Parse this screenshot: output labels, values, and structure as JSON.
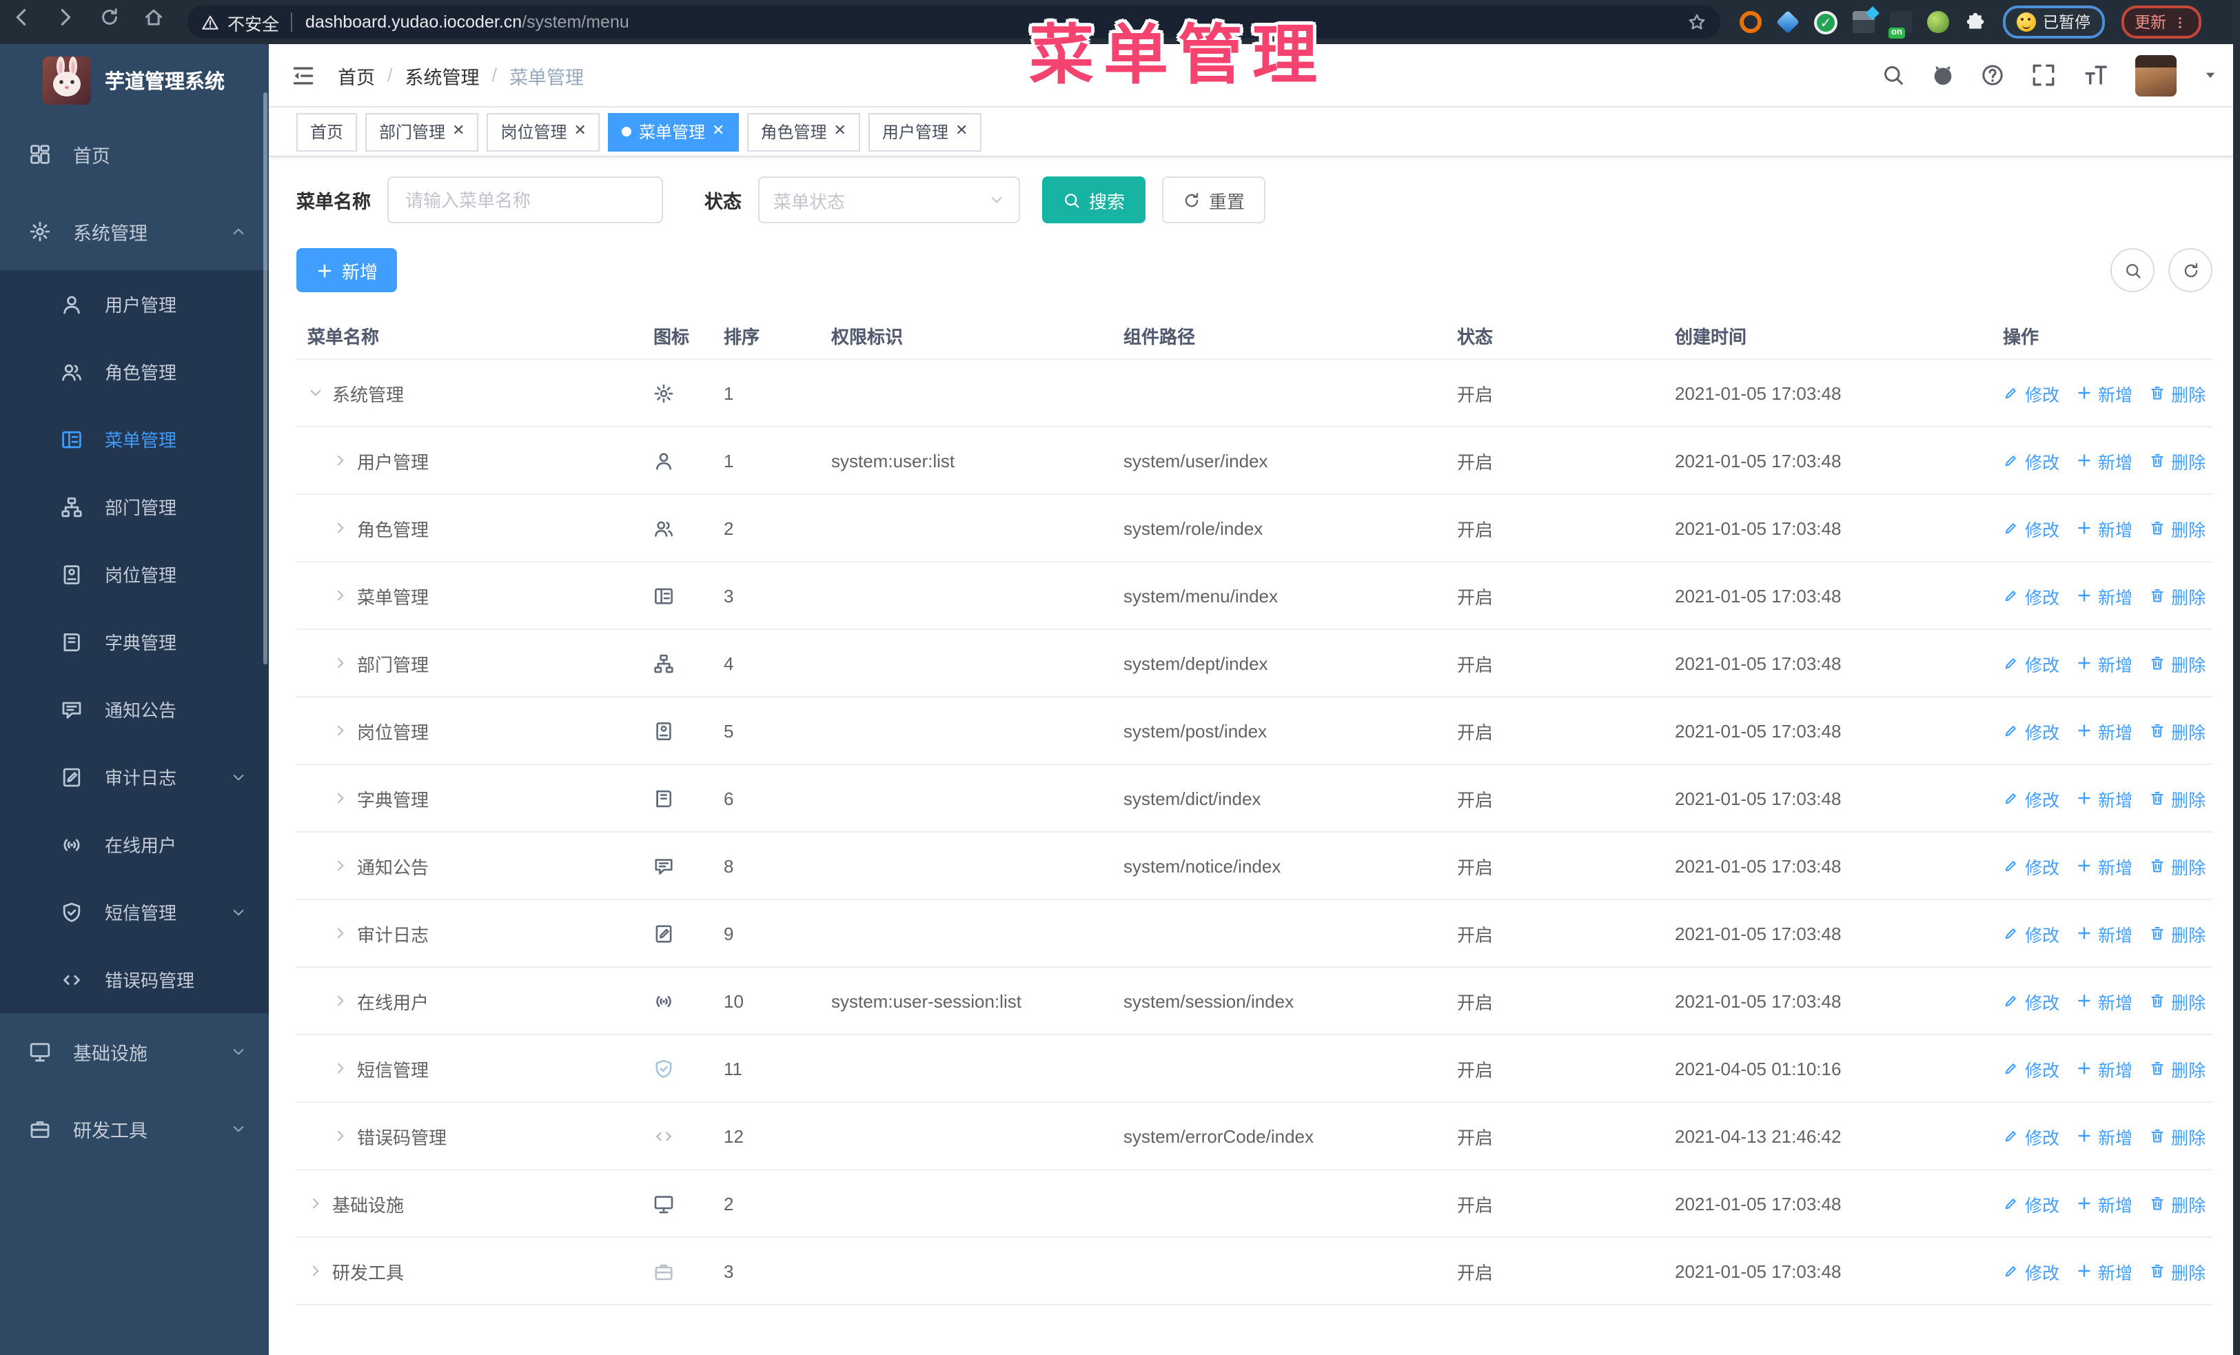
{
  "browser": {
    "security_label": "不安全",
    "url_host": "dashboard.yudao.iocoder.cn",
    "url_path": "/system/menu",
    "paused_label": "已暂停",
    "update_label": "更新"
  },
  "annotation": {
    "text": "菜单管理",
    "color": "#f4436e"
  },
  "sidebar": {
    "logo_title": "芋道管理系统",
    "items": [
      {
        "label": "首页",
        "icon": "dashboard",
        "level": 0
      },
      {
        "label": "系统管理",
        "icon": "gear",
        "level": 0,
        "arrow": "up"
      },
      {
        "label": "用户管理",
        "icon": "user",
        "level": 1
      },
      {
        "label": "角色管理",
        "icon": "users",
        "level": 1
      },
      {
        "label": "菜单管理",
        "icon": "menu",
        "level": 1,
        "active": true
      },
      {
        "label": "部门管理",
        "icon": "tree",
        "level": 1
      },
      {
        "label": "岗位管理",
        "icon": "post",
        "level": 1
      },
      {
        "label": "字典管理",
        "icon": "dict",
        "level": 1
      },
      {
        "label": "通知公告",
        "icon": "notice",
        "level": 1
      },
      {
        "label": "审计日志",
        "icon": "log",
        "level": 1,
        "arrow": "down"
      },
      {
        "label": "在线用户",
        "icon": "online",
        "level": 1
      },
      {
        "label": "短信管理",
        "icon": "sms",
        "level": 1,
        "arrow": "down"
      },
      {
        "label": "错误码管理",
        "icon": "code",
        "level": 1
      },
      {
        "label": "基础设施",
        "icon": "monitor",
        "level": 0,
        "arrow": "down"
      },
      {
        "label": "研发工具",
        "icon": "tool",
        "level": 0,
        "arrow": "down"
      }
    ]
  },
  "header": {
    "breadcrumb": [
      "首页",
      "系统管理",
      "菜单管理"
    ]
  },
  "tabs": [
    {
      "label": "首页",
      "closable": false,
      "active": false
    },
    {
      "label": "部门管理",
      "closable": true,
      "active": false
    },
    {
      "label": "岗位管理",
      "closable": true,
      "active": false
    },
    {
      "label": "菜单管理",
      "closable": true,
      "active": true
    },
    {
      "label": "角色管理",
      "closable": true,
      "active": false
    },
    {
      "label": "用户管理",
      "closable": true,
      "active": false
    }
  ],
  "filters": {
    "name_label": "菜单名称",
    "name_placeholder": "请输入菜单名称",
    "status_label": "状态",
    "status_placeholder": "菜单状态",
    "search_label": "搜索",
    "reset_label": "重置"
  },
  "toolbar": {
    "add_label": "新增"
  },
  "table": {
    "columns": [
      "菜单名称",
      "图标",
      "排序",
      "权限标识",
      "组件路径",
      "状态",
      "创建时间",
      "操作"
    ],
    "action_labels": [
      "修改",
      "新增",
      "删除"
    ],
    "rows": [
      {
        "name": "系统管理",
        "icon": "gear",
        "level": 0,
        "expand": "down",
        "order": "1",
        "perm": "",
        "path": "",
        "status": "开启",
        "created": "2021-01-05 17:03:48"
      },
      {
        "name": "用户管理",
        "icon": "user",
        "level": 1,
        "expand": "right",
        "order": "1",
        "perm": "system:user:list",
        "path": "system/user/index",
        "status": "开启",
        "created": "2021-01-05 17:03:48"
      },
      {
        "name": "角色管理",
        "icon": "users",
        "level": 1,
        "expand": "right",
        "order": "2",
        "perm": "",
        "path": "system/role/index",
        "status": "开启",
        "created": "2021-01-05 17:03:48"
      },
      {
        "name": "菜单管理",
        "icon": "menu",
        "level": 1,
        "expand": "right",
        "order": "3",
        "perm": "",
        "path": "system/menu/index",
        "status": "开启",
        "created": "2021-01-05 17:03:48"
      },
      {
        "name": "部门管理",
        "icon": "tree",
        "level": 1,
        "expand": "right",
        "order": "4",
        "perm": "",
        "path": "system/dept/index",
        "status": "开启",
        "created": "2021-01-05 17:03:48"
      },
      {
        "name": "岗位管理",
        "icon": "post",
        "level": 1,
        "expand": "right",
        "order": "5",
        "perm": "",
        "path": "system/post/index",
        "status": "开启",
        "created": "2021-01-05 17:03:48"
      },
      {
        "name": "字典管理",
        "icon": "dict",
        "level": 1,
        "expand": "right",
        "order": "6",
        "perm": "",
        "path": "system/dict/index",
        "status": "开启",
        "created": "2021-01-05 17:03:48"
      },
      {
        "name": "通知公告",
        "icon": "notice",
        "level": 1,
        "expand": "right",
        "order": "8",
        "perm": "",
        "path": "system/notice/index",
        "status": "开启",
        "created": "2021-01-05 17:03:48"
      },
      {
        "name": "审计日志",
        "icon": "log",
        "level": 1,
        "expand": "right",
        "order": "9",
        "perm": "",
        "path": "",
        "status": "开启",
        "created": "2021-01-05 17:03:48"
      },
      {
        "name": "在线用户",
        "icon": "online",
        "level": 1,
        "expand": "right",
        "order": "10",
        "perm": "system:user-session:list",
        "path": "system/session/index",
        "status": "开启",
        "created": "2021-01-05 17:03:48"
      },
      {
        "name": "短信管理",
        "icon": "sms",
        "iconTone": "muted",
        "level": 1,
        "expand": "right",
        "order": "11",
        "perm": "",
        "path": "",
        "status": "开启",
        "created": "2021-04-05 01:10:16"
      },
      {
        "name": "错误码管理",
        "icon": "code",
        "iconTone": "muted2",
        "level": 1,
        "expand": "right",
        "order": "12",
        "perm": "",
        "path": "system/errorCode/index",
        "status": "开启",
        "created": "2021-04-13 21:46:42"
      },
      {
        "name": "基础设施",
        "icon": "monitor",
        "level": 0,
        "expand": "right",
        "order": "2",
        "perm": "",
        "path": "",
        "status": "开启",
        "created": "2021-01-05 17:03:48"
      },
      {
        "name": "研发工具",
        "icon": "tool",
        "iconTone": "muted2",
        "level": 0,
        "expand": "right",
        "order": "3",
        "perm": "",
        "path": "",
        "status": "开启",
        "created": "2021-01-05 17:03:48"
      }
    ]
  },
  "colors": {
    "accent": "#409eff",
    "search_button": "#17b3a3",
    "annotation": "#f4436e",
    "sidebar_bg": "#2f4964",
    "sidebar_sub_bg": "#223650"
  }
}
